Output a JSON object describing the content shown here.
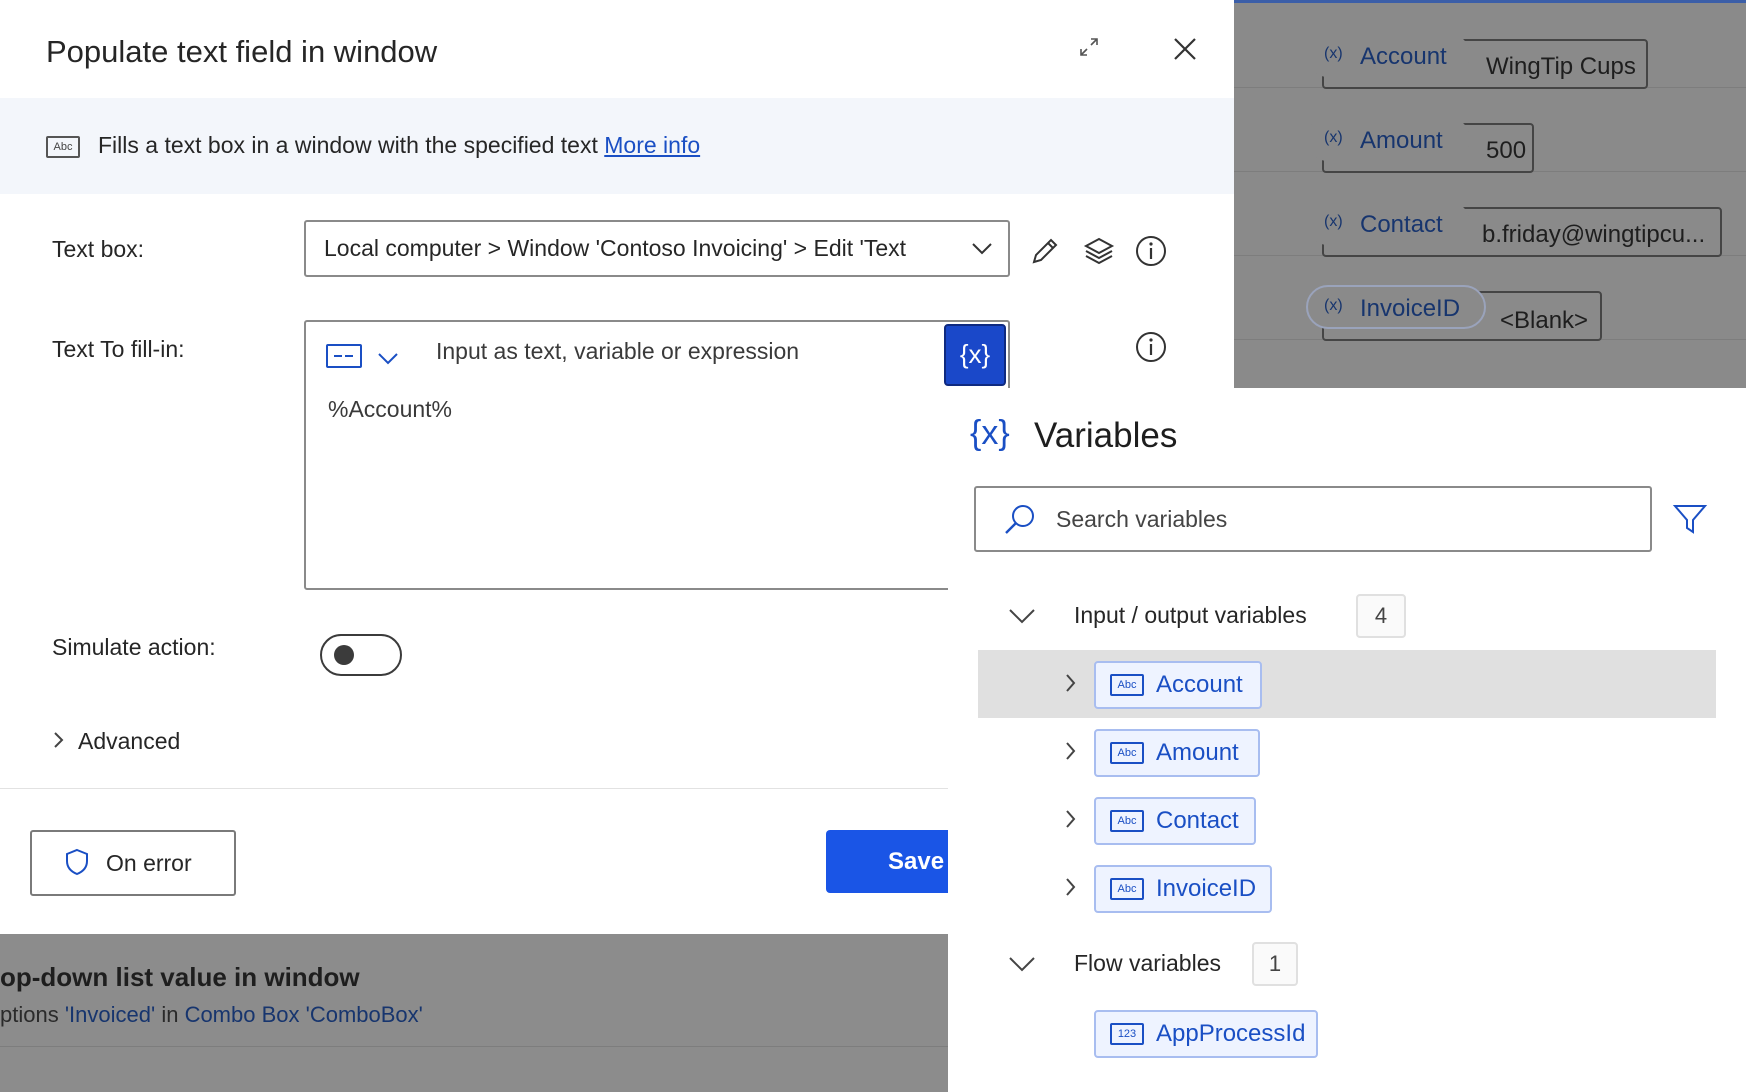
{
  "dialog": {
    "title": "Populate text field in window",
    "banner_text": "Fills a text box in a window with the specified text",
    "banner_link": "More info",
    "textbox_label": "Text box:",
    "textbox_value": "Local computer > Window 'Contoso Invoicing' > Edit 'Text",
    "fill_label": "Text To fill-in:",
    "fill_placeholder": "Input as text, variable or expression",
    "fill_value": "%Account%",
    "fx_label": "{x}",
    "simulate_label": "Simulate action:",
    "simulate_on": false,
    "advanced_label": "Advanced",
    "on_error_label": "On error",
    "save_label": "Save"
  },
  "background_action": {
    "title": "op-down list value in window",
    "desc_prefix": "ptions",
    "desc_value": "'Invoiced'",
    "desc_in": "in",
    "desc_target": "Combo Box 'ComboBox'"
  },
  "mapping": {
    "rows": [
      {
        "name": "Account",
        "value": "WingTip Cups",
        "icon": "(x)"
      },
      {
        "name": "Amount",
        "value": "500",
        "icon": "(x)"
      },
      {
        "name": "Contact",
        "value": "b.friday@wingtipcu...",
        "icon": "(x)"
      },
      {
        "name": "InvoiceID",
        "value": "<Blank>",
        "icon": "(x)"
      }
    ]
  },
  "variables": {
    "header_icon": "{x}",
    "title": "Variables",
    "search_placeholder": "Search variables",
    "groups": [
      {
        "label": "Input / output variables",
        "count": "4",
        "items": [
          {
            "name": "Account",
            "type_icon": "Abc",
            "selected": true
          },
          {
            "name": "Amount",
            "type_icon": "Abc"
          },
          {
            "name": "Contact",
            "type_icon": "Abc"
          },
          {
            "name": "InvoiceID",
            "type_icon": "Abc"
          }
        ]
      },
      {
        "label": "Flow variables",
        "count": "1",
        "items": [
          {
            "name": "AppProcessId",
            "type_icon": "123"
          }
        ]
      }
    ]
  },
  "colors": {
    "accent": "#1a55e6",
    "link": "#1a4fc4",
    "fx_button": "#1a48c9"
  }
}
